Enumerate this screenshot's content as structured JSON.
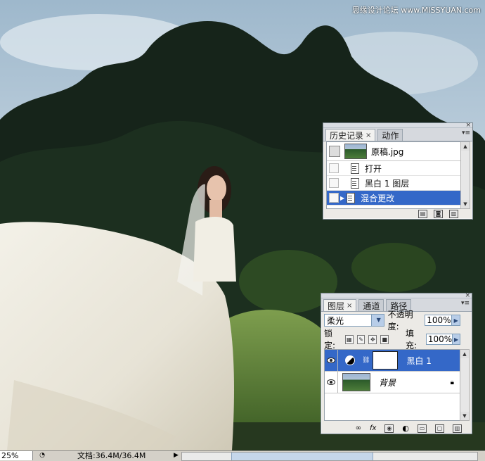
{
  "watermark": "思缘设计论坛 www.MISSYUAN.com",
  "history_panel": {
    "tabs": [
      {
        "label": "历史记录",
        "close": "×"
      },
      {
        "label": "动作"
      }
    ],
    "snapshot": {
      "label": "原稿.jpg"
    },
    "items": [
      {
        "label": "打开"
      },
      {
        "label": "黑白 1 图层"
      },
      {
        "label": "混合更改"
      }
    ],
    "footer_icons": [
      "new-document-icon",
      "camera-icon",
      "trash-icon"
    ]
  },
  "layers_panel": {
    "tabs": [
      {
        "label": "图层",
        "close": "×"
      },
      {
        "label": "通道"
      },
      {
        "label": "路径"
      }
    ],
    "blend_mode": "柔光",
    "opacity_label": "不透明度:",
    "opacity_value": "100%",
    "lock_label": "锁定:",
    "fill_label": "填充:",
    "fill_value": "100%",
    "layers": [
      {
        "name": "黑白 1",
        "type": "adjustment"
      },
      {
        "name": "背景",
        "type": "background"
      }
    ],
    "footer_icons": [
      "link-icon",
      "fx-icon",
      "mask-icon",
      "adjustment-icon",
      "folder-icon",
      "new-layer-icon",
      "trash-icon"
    ]
  },
  "status_bar": {
    "zoom": "25%",
    "doc_info": "文档:36.4M/36.4M"
  }
}
